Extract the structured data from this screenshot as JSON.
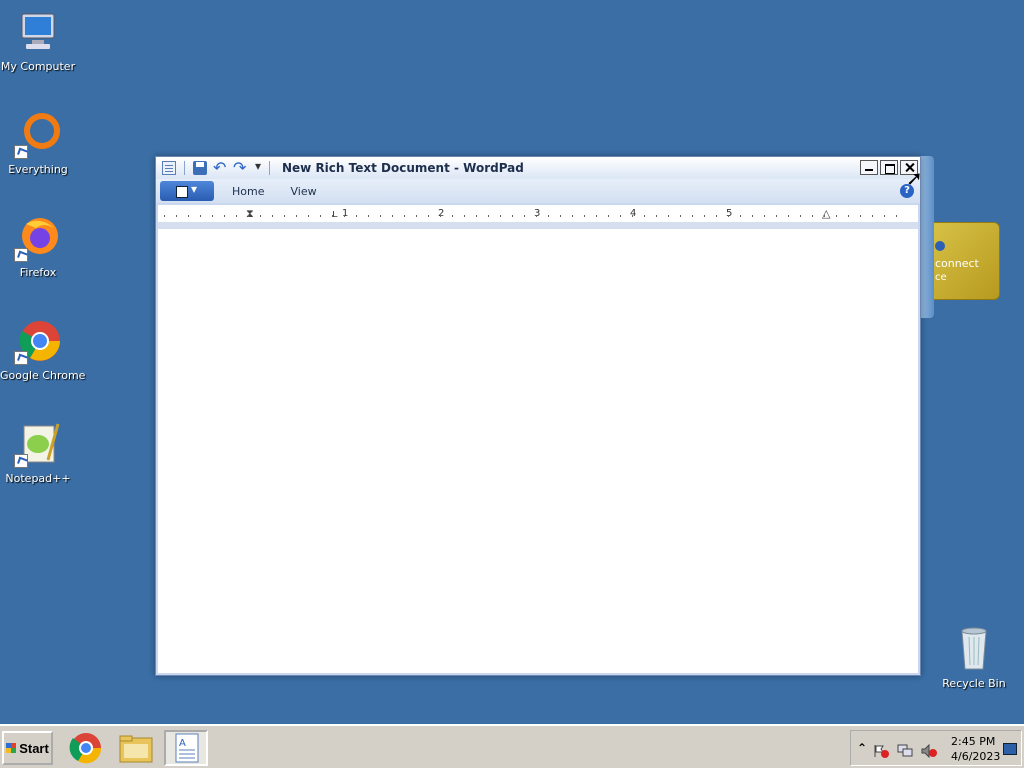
{
  "desktop": {
    "icons": [
      {
        "label": "My Computer",
        "icon": "computer-icon"
      },
      {
        "label": "Everything",
        "icon": "everything-icon"
      },
      {
        "label": "Firefox",
        "icon": "firefox-icon"
      },
      {
        "label": "Google Chrome",
        "icon": "chrome-icon"
      },
      {
        "label": "Notepad++",
        "icon": "notepadpp-icon"
      },
      {
        "label": "Recycle Bin",
        "icon": "recycle-bin-icon"
      }
    ],
    "gadget": {
      "line1": "connect",
      "line2": "ce"
    }
  },
  "window": {
    "title": "New Rich Text Document - WordPad",
    "ribbon_tabs": [
      "Home",
      "View"
    ],
    "help_label": "?",
    "ruler_numbers": [
      "1",
      "2",
      "3",
      "4",
      "5"
    ],
    "document_text": ""
  },
  "taskbar": {
    "start_label": "Start",
    "items": [
      {
        "name": "chrome",
        "icon": "chrome-icon"
      },
      {
        "name": "file-explorer",
        "icon": "folder-icon"
      },
      {
        "name": "wordpad",
        "icon": "wordpad-icon",
        "active": true
      }
    ],
    "tray": {
      "time": "2:45 PM",
      "date": "4/6/2023"
    }
  },
  "colors": {
    "desktop_bg": "#3a6ea5",
    "taskbar_bg": "#d4d0c8",
    "window_frame": "#c9d8ef"
  }
}
